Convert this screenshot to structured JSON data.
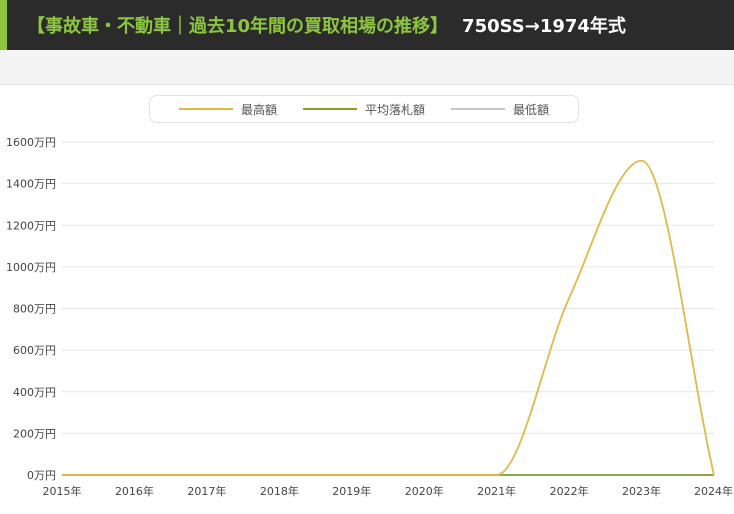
{
  "header": {
    "title": "【事故車・不動車｜過去10年間の買取相場の推移】",
    "subtitle": "750SS→1974年式"
  },
  "colors": {
    "title_accent": "#8cc63f",
    "max_line": "#e2b84a",
    "avg_line": "#7da42b",
    "min_line": "#c8c8c8"
  },
  "chart_data": {
    "type": "line",
    "title": "",
    "xlabel": "",
    "ylabel": "",
    "x": [
      "2015年",
      "2016年",
      "2017年",
      "2018年",
      "2019年",
      "2020年",
      "2021年",
      "2022年",
      "2023年",
      "2024年"
    ],
    "y_tick_labels": [
      "0万円",
      "200万円",
      "400万円",
      "600万円",
      "800万円",
      "1000万円",
      "1200万円",
      "1400万円",
      "1600万円"
    ],
    "ylim": [
      0,
      1600
    ],
    "y_unit": "万円",
    "grid": true,
    "legend_position": "top-center",
    "series": [
      {
        "name": "最高額",
        "values": [
          0,
          0,
          0,
          0,
          0,
          0,
          0,
          850,
          1510,
          0
        ]
      },
      {
        "name": "平均落札額",
        "values": [
          0,
          0,
          0,
          0,
          0,
          0,
          0,
          0,
          0,
          0
        ]
      },
      {
        "name": "最低額",
        "values": [
          0,
          0,
          0,
          0,
          0,
          0,
          0,
          0,
          0,
          0
        ]
      }
    ]
  }
}
